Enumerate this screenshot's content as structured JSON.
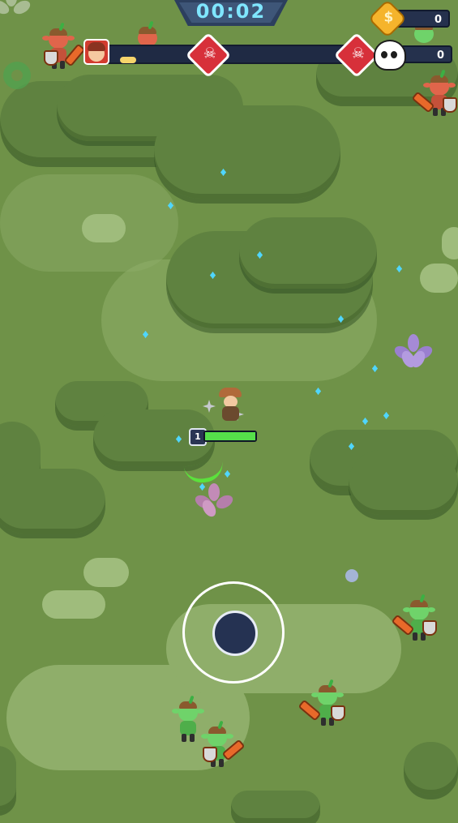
{
  "hud": {
    "timer": "00:02",
    "coins": "0",
    "kills": "0",
    "coin_icon_label": "$",
    "stage_progress": 0.0
  },
  "player": {
    "level": "1",
    "health": 1.0
  },
  "colors": {
    "grass": "#6f9248",
    "bush": "#5f8240",
    "path": "#8fae6a",
    "gem": "#4fd6ff",
    "goblin_green": "#6fd36a",
    "goblin_red": "#e0654b",
    "boss_marker": "#d7303a",
    "timer_text": "#7fe6ff",
    "hp": "#55e04a"
  },
  "icons": [
    "timer-frame",
    "player-avatar",
    "boss-skull-marker",
    "boss-skull-marker",
    "coin-icon",
    "skull-icon",
    "settings-gear-icon",
    "joystick"
  ]
}
